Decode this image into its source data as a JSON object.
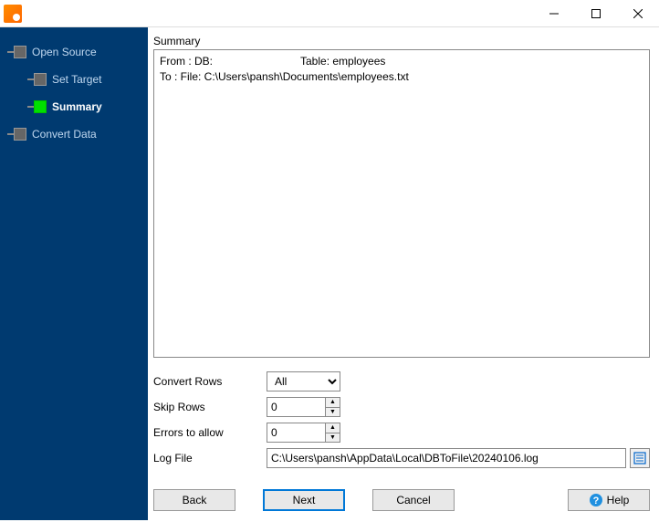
{
  "titlebar": {
    "minimize": "—",
    "maximize": "☐",
    "close": "✕"
  },
  "sidebar": {
    "steps": [
      {
        "label": "Open Source",
        "active": false,
        "child": false
      },
      {
        "label": "Set Target",
        "active": false,
        "child": true
      },
      {
        "label": "Summary",
        "active": true,
        "child": true
      },
      {
        "label": "Convert Data",
        "active": false,
        "child": false
      }
    ]
  },
  "summary": {
    "label": "Summary",
    "from_db_label": "From : DB:",
    "from_table": "Table: employees",
    "to_line": "To : File: C:\\Users\\pansh\\Documents\\employees.txt"
  },
  "options": {
    "convert_rows": {
      "label": "Convert Rows",
      "value": "All"
    },
    "skip_rows": {
      "label": "Skip Rows",
      "value": "0"
    },
    "errors_allow": {
      "label": "Errors to allow",
      "value": "0"
    },
    "log_file": {
      "label": "Log File",
      "value": "C:\\Users\\pansh\\AppData\\Local\\DBToFile\\20240106.log"
    }
  },
  "buttons": {
    "back": "Back",
    "next": "Next",
    "cancel": "Cancel",
    "help": "Help"
  }
}
